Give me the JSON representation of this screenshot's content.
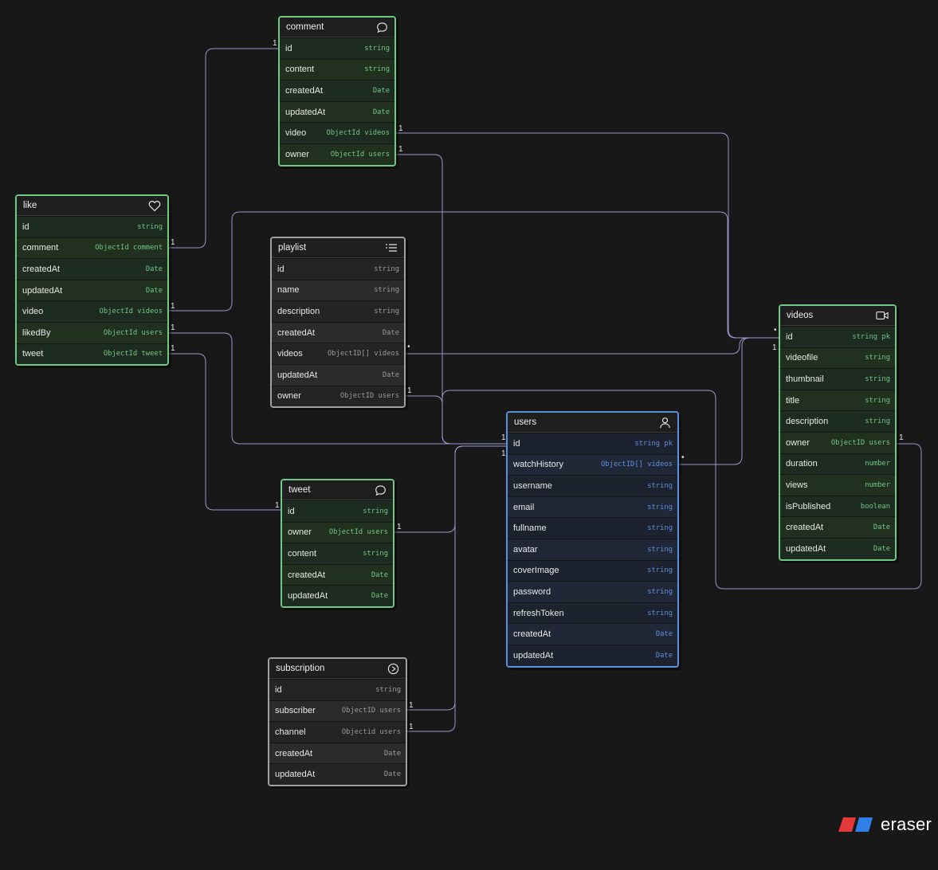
{
  "entities": {
    "comment": {
      "title": "comment",
      "icon": "speech-bubble-icon",
      "fields": [
        {
          "name": "id",
          "type": "string"
        },
        {
          "name": "content",
          "type": "string"
        },
        {
          "name": "createdAt",
          "type": "Date"
        },
        {
          "name": "updatedAt",
          "type": "Date"
        },
        {
          "name": "video",
          "type": "ObjectId videos"
        },
        {
          "name": "owner",
          "type": "ObjectId users"
        }
      ]
    },
    "like": {
      "title": "like",
      "icon": "heart-icon",
      "fields": [
        {
          "name": "id",
          "type": "string"
        },
        {
          "name": "comment",
          "type": "ObjectId comment"
        },
        {
          "name": "createdAt",
          "type": "Date"
        },
        {
          "name": "updatedAt",
          "type": "Date"
        },
        {
          "name": "video",
          "type": "ObjectId videos"
        },
        {
          "name": "likedBy",
          "type": "ObjectId users"
        },
        {
          "name": "tweet",
          "type": "ObjectId tweet"
        }
      ]
    },
    "playlist": {
      "title": "playlist",
      "icon": "list-icon",
      "fields": [
        {
          "name": "id",
          "type": "string"
        },
        {
          "name": "name",
          "type": "string"
        },
        {
          "name": "description",
          "type": "string"
        },
        {
          "name": "createdAt",
          "type": "Date"
        },
        {
          "name": "videos",
          "type": "ObjectID[] videos"
        },
        {
          "name": "updatedAt",
          "type": "Date"
        },
        {
          "name": "owner",
          "type": "ObjectID users"
        }
      ]
    },
    "videos": {
      "title": "videos",
      "icon": "video-camera-icon",
      "fields": [
        {
          "name": "id",
          "type": "string pk"
        },
        {
          "name": "videofile",
          "type": "string"
        },
        {
          "name": "thumbnail",
          "type": "string"
        },
        {
          "name": "title",
          "type": "string"
        },
        {
          "name": "description",
          "type": "string"
        },
        {
          "name": "owner",
          "type": "ObjectID users"
        },
        {
          "name": "duration",
          "type": "number"
        },
        {
          "name": "views",
          "type": "number"
        },
        {
          "name": "isPublished",
          "type": "boolean"
        },
        {
          "name": "createdAt",
          "type": "Date"
        },
        {
          "name": "updatedAt",
          "type": "Date"
        }
      ]
    },
    "users": {
      "title": "users",
      "icon": "user-icon",
      "fields": [
        {
          "name": "id",
          "type": "string pk"
        },
        {
          "name": "watchHistory",
          "type": "ObjectID[] videos"
        },
        {
          "name": "username",
          "type": "string"
        },
        {
          "name": "email",
          "type": "string"
        },
        {
          "name": "fullname",
          "type": "string"
        },
        {
          "name": "avatar",
          "type": "string"
        },
        {
          "name": "coverImage",
          "type": "string"
        },
        {
          "name": "password",
          "type": "string"
        },
        {
          "name": "refreshToken",
          "type": "string"
        },
        {
          "name": "createdAt",
          "type": "Date"
        },
        {
          "name": "updatedAt",
          "type": "Date"
        }
      ]
    },
    "tweet": {
      "title": "tweet",
      "icon": "speech-bubble-icon",
      "fields": [
        {
          "name": "id",
          "type": "string"
        },
        {
          "name": "owner",
          "type": "ObjectId users"
        },
        {
          "name": "content",
          "type": "string"
        },
        {
          "name": "createdAt",
          "type": "Date"
        },
        {
          "name": "updatedAt",
          "type": "Date"
        }
      ]
    },
    "subscription": {
      "title": "subscription",
      "icon": "play-circle-icon",
      "fields": [
        {
          "name": "id",
          "type": "string"
        },
        {
          "name": "subscriber",
          "type": "ObjectID users"
        },
        {
          "name": "channel",
          "type": "Objectid users"
        },
        {
          "name": "createdAt",
          "type": "Date"
        },
        {
          "name": "updatedAt",
          "type": "Date"
        }
      ]
    }
  },
  "cardinality": {
    "one": "1",
    "many": "•"
  },
  "brand": {
    "name": "eraser",
    "logo_colors": [
      "#e5383b",
      "#2f7fe6"
    ]
  },
  "colors": {
    "background": "#181818",
    "green_border": "#6fc985",
    "gray_border": "#a0a0a0",
    "blue_border": "#5b8fe0",
    "connector": "#9d9dd6"
  }
}
